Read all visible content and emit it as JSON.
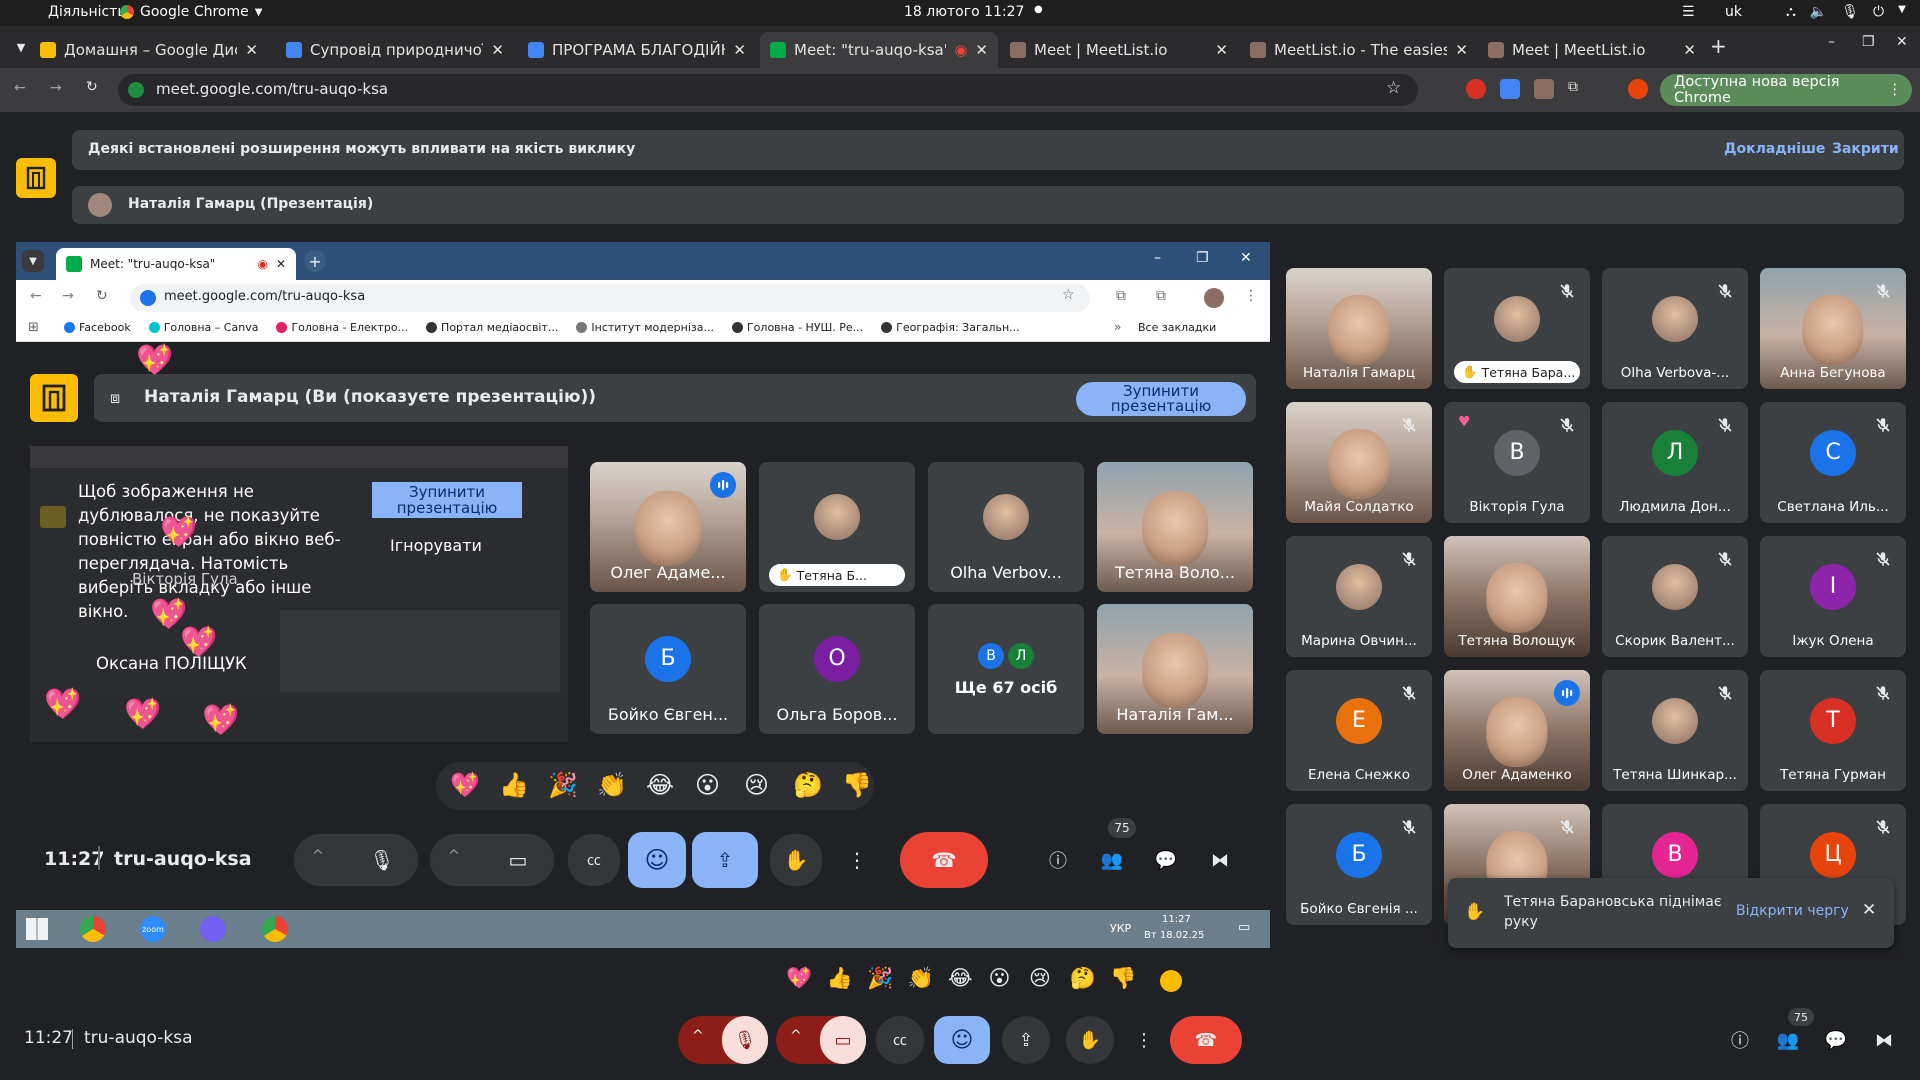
{
  "system": {
    "activities": "Діяльність",
    "app_menu": "Google Chrome",
    "datetime": "18 лютого  11:27",
    "lang": "uk"
  },
  "tabs": [
    {
      "label": "Домашня – Google Дис",
      "color": "#fbbc04"
    },
    {
      "label": "Супровід природничої",
      "color": "#4285f4"
    },
    {
      "label": "ПРОГРАМА БЛАГОДІЙН",
      "color": "#4285f4"
    },
    {
      "label": "Meet: \"tru-auqo-ksa\"",
      "color": "#00ac47"
    },
    {
      "label": "Meet | MeetList.io",
      "color": "#8d6e63"
    },
    {
      "label": "MeetList.io - The easiest",
      "color": "#8d6e63"
    },
    {
      "label": "Meet | MeetList.io",
      "color": "#8d6e63"
    }
  ],
  "address": {
    "url": "meet.google.com/tru-auqo-ksa",
    "update_label": "Доступна нова версія Chrome"
  },
  "banner": {
    "text": "Деякі встановлені розширення можуть впливати на якість виклику",
    "more": "Докладніше",
    "close": "Закрити"
  },
  "presenter": {
    "label": "Наталія Гамарц (Презентація)"
  },
  "inner": {
    "tab_label": "Meet: \"tru-auqo-ksa\"",
    "url": "meet.google.com/tru-auqo-ksa",
    "bookmarks": [
      "Facebook",
      "Головна – Canva",
      "Головна - Електро...",
      "Портал медіаосвіт...",
      "Інститут модерніза...",
      "Головна - НУШ. Ре...",
      "Географія: Загальн..."
    ],
    "all_bookmarks": "Все закладки",
    "presenting_text": "Наталія Гамарц (Ви (показуєте презентацію))",
    "stop_label": "Зупинити презентацію",
    "mirror_warning": "Щоб зображення не дублювалося, не показуйте повністю екран або вікно веб-переглядача. Натомість виберіть вкладку або інше вікно.",
    "mirror_stop": "Зупинити презентацію",
    "mirror_ignore": "Ігнорувати",
    "overlay_name_1": "Вікторія Гула",
    "overlay_name_2": "Оксана ПОЛІЩУК",
    "tiles": [
      {
        "name": "Олег Адаме...",
        "type": "photo",
        "speaking": true
      },
      {
        "name": "Тетяна Б...",
        "type": "avatar-photo",
        "hand": true
      },
      {
        "name": "Olha Verbov...",
        "type": "avatar-photo"
      },
      {
        "name": "Тетяна Воло...",
        "type": "photo"
      },
      {
        "name": "Бойко Євген...",
        "type": "letter",
        "letter": "Б",
        "color": "#1a73e8"
      },
      {
        "name": "Ольга Боров...",
        "type": "letter",
        "letter": "О",
        "color": "#7b1fa2"
      },
      {
        "name": "Ще 67 осіб",
        "type": "more",
        "letters": [
          "В",
          "Л"
        ]
      },
      {
        "name": "Наталія Гам...",
        "type": "photo"
      }
    ],
    "time": "11:27",
    "code": "tru-auqo-ksa",
    "participants_badge": "75",
    "taskbar_lang": "УКР",
    "taskbar_time": "11:27",
    "taskbar_date": "Вт 18.02.25"
  },
  "reactions": [
    "💖",
    "👍",
    "🎉",
    "👏",
    "😂",
    "😮",
    "😢",
    "🤔",
    "👎"
  ],
  "grid": [
    {
      "name": "Наталія Гамарц",
      "type": "photo",
      "mic": false
    },
    {
      "name": "Тетяна Бара...",
      "type": "avatar-photo",
      "hand": true,
      "mic": true
    },
    {
      "name": "Olha Verbova-...",
      "type": "avatar-photo",
      "mic": true
    },
    {
      "name": "Анна Бегунова",
      "type": "photo",
      "mic": true
    },
    {
      "name": "Майя Солдатко",
      "type": "photo",
      "mic": true
    },
    {
      "name": "Вікторія Гула",
      "type": "letter",
      "letter": "В",
      "color": "#5f6368",
      "mic": true,
      "heart": true
    },
    {
      "name": "Людмила Дон...",
      "type": "letter",
      "letter": "Л",
      "color": "#188038",
      "mic": true
    },
    {
      "name": "Светлана Иль...",
      "type": "letter",
      "letter": "С",
      "color": "#1a73e8",
      "mic": true
    },
    {
      "name": "Марина Овчин...",
      "type": "avatar-photo",
      "mic": true
    },
    {
      "name": "Тетяна Волощук",
      "type": "photo",
      "mic": false
    },
    {
      "name": "Скорик Валент...",
      "type": "avatar-photo",
      "mic": true
    },
    {
      "name": "Іжук Олена",
      "type": "letter",
      "letter": "І",
      "color": "#8e24aa",
      "mic": true
    },
    {
      "name": "Елена Снежко",
      "type": "letter",
      "letter": "Е",
      "color": "#e8710a",
      "mic": true
    },
    {
      "name": "Олег Адаменко",
      "type": "photo",
      "mic": false,
      "speaking": true
    },
    {
      "name": "Тетяна Шинкар...",
      "type": "avatar-photo",
      "mic": true
    },
    {
      "name": "Тетяна Гурман",
      "type": "letter",
      "letter": "Т",
      "color": "#d93025",
      "mic": true
    },
    {
      "name": "Бойко Євгенія ...",
      "type": "letter",
      "letter": "Б",
      "color": "#1a73e8",
      "mic": true
    },
    {
      "name": "",
      "type": "photo",
      "mic": true
    },
    {
      "name": "",
      "type": "letter",
      "letter": "В",
      "color": "#e52592",
      "mic": false
    },
    {
      "name": "",
      "type": "letter",
      "letter": "Ц",
      "color": "#e8430a",
      "mic": true
    }
  ],
  "toast": {
    "text": "Тетяна Барановська піднімає руку",
    "action": "Відкрити чергу"
  },
  "bottom": {
    "time": "11:27",
    "code": "tru-auqo-ksa",
    "participants_badge": "75"
  }
}
